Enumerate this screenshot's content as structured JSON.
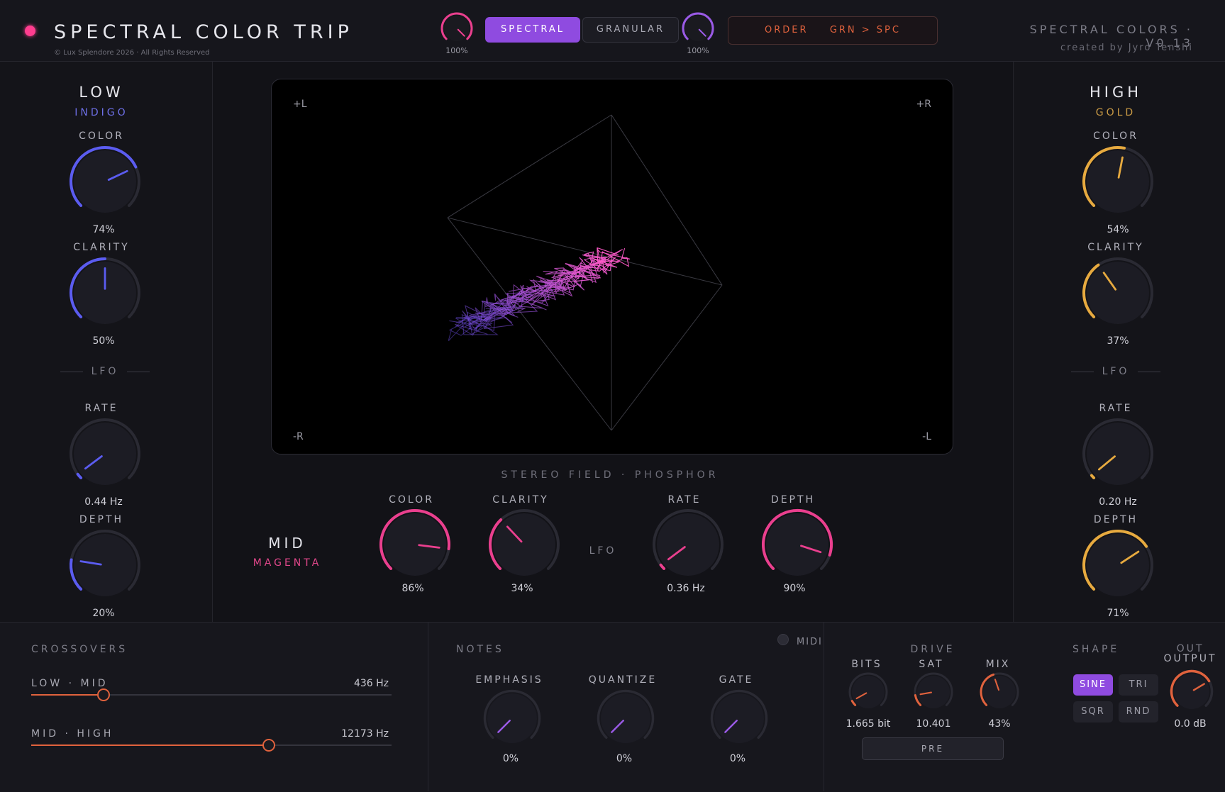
{
  "header": {
    "title": "SPECTRAL COLOR TRIP",
    "copyright": "© Lux Splendore 2026 · All Rights Reserved",
    "input_trim": "100%",
    "output_trim": "100%",
    "mode_spectral": "SPECTRAL",
    "mode_granular": "GRANULAR",
    "order_label": "ORDER",
    "order_value": "GRN > SPC",
    "version": "SPECTRAL COLORS · V0.13",
    "credit": "created by Jyro Tenshi",
    "power_color": "#ff3d8f"
  },
  "low": {
    "name": "LOW",
    "sub": "INDIGO",
    "accent": "#5b5cf0",
    "color_label": "COLOR",
    "color_value": "74%",
    "clarity_label": "CLARITY",
    "clarity_value": "50%",
    "lfo_label": "LFO",
    "rate_label": "RATE",
    "rate_value": "0.44 Hz",
    "depth_label": "DEPTH",
    "depth_value": "20%"
  },
  "high": {
    "name": "HIGH",
    "sub": "GOLD",
    "accent": "#e7aa3f",
    "color_label": "COLOR",
    "color_value": "54%",
    "clarity_label": "CLARITY",
    "clarity_value": "37%",
    "lfo_label": "LFO",
    "rate_label": "RATE",
    "rate_value": "0.20 Hz",
    "depth_label": "DEPTH",
    "depth_value": "71%"
  },
  "mid": {
    "name": "MID",
    "sub": "MAGENTA",
    "accent": "#ea3f8e",
    "color_label": "COLOR",
    "color_value": "86%",
    "clarity_label": "CLARITY",
    "clarity_value": "34%",
    "lfo_label": "LFO",
    "rate_label": "RATE",
    "rate_value": "0.36 Hz",
    "depth_label": "DEPTH",
    "depth_value": "90%"
  },
  "scope": {
    "label": "STEREO FIELD · PHOSPHOR",
    "corner_tl": "+L",
    "corner_tr": "+R",
    "corner_bl": "-R",
    "corner_br": "-L"
  },
  "crossovers": {
    "title": "CROSSOVERS",
    "low_mid_label": "LOW · MID",
    "low_mid_value": "436 Hz",
    "low_mid_fraction": 0.2,
    "mid_high_label": "MID · HIGH",
    "mid_high_value": "12173 Hz",
    "mid_high_fraction": 0.66
  },
  "notes": {
    "title": "NOTES",
    "midi_label": "MIDI",
    "emphasis_label": "EMPHASIS",
    "emphasis_value": "0%",
    "quantize_label": "QUANTIZE",
    "quantize_value": "0%",
    "gate_label": "GATE",
    "gate_value": "0%",
    "accent": "#9a5ae6"
  },
  "drive": {
    "title": "DRIVE",
    "bits_label": "BITS",
    "bits_value": "1.665 bit",
    "sat_label": "SAT",
    "sat_value": "10.401",
    "mix_label": "MIX",
    "mix_value": "43%",
    "pre_label": "PRE",
    "accent": "#e0623d"
  },
  "shape": {
    "title": "SHAPE",
    "sine": "SINE",
    "tri": "TRI",
    "sqr": "SQR",
    "rnd": "RND",
    "selected": "SINE"
  },
  "output": {
    "title_top": "OUT",
    "title": "OUTPUT",
    "value": "0.0 dB"
  }
}
